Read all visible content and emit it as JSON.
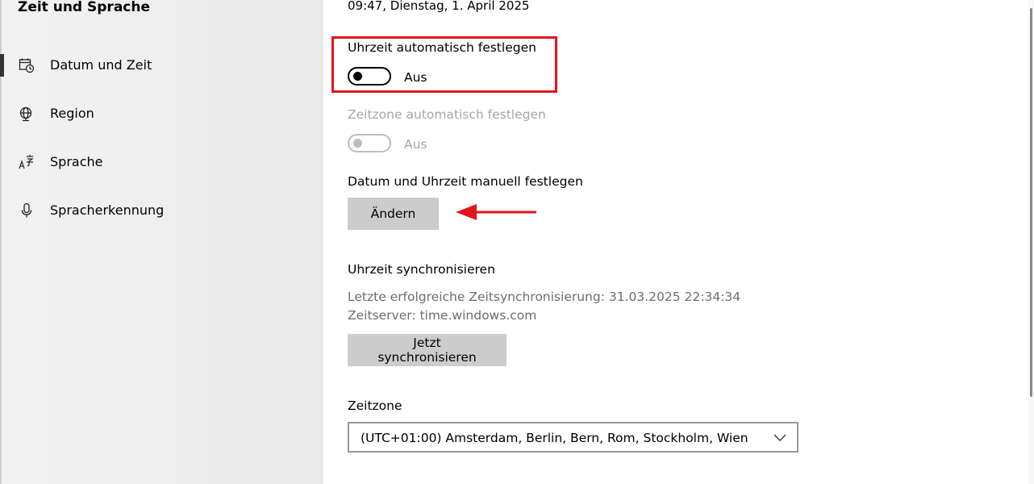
{
  "sidebar": {
    "title": "Zeit und Sprache",
    "items": [
      {
        "label": "Datum und Zeit",
        "icon": "calendar-clock-icon",
        "active": true
      },
      {
        "label": "Region",
        "icon": "globe-icon"
      },
      {
        "label": "Sprache",
        "icon": "language-icon"
      },
      {
        "label": "Spracherkennung",
        "icon": "microphone-icon"
      }
    ]
  },
  "main": {
    "datetime": "09:47, Dienstag, 1. April 2025",
    "auto_time": {
      "label": "Uhrzeit automatisch festlegen",
      "state": "Aus"
    },
    "auto_timezone": {
      "label": "Zeitzone automatisch festlegen",
      "state": "Aus"
    },
    "manual": {
      "label": "Datum und Uhrzeit manuell festlegen",
      "button": "Ändern"
    },
    "sync": {
      "title": "Uhrzeit synchronisieren",
      "last_sync": "Letzte erfolgreiche Zeitsynchronisierung: 31.03.2025 22:34:34",
      "server": "Zeitserver: time.windows.com",
      "button": "Jetzt synchronisieren"
    },
    "timezone": {
      "label": "Zeitzone",
      "value": "(UTC+01:00) Amsterdam, Berlin, Bern, Rom, Stockholm, Wien"
    }
  },
  "colors": {
    "highlight": "#e0161d",
    "button_bg": "#cccccc",
    "disabled_text": "#a6a6a6"
  }
}
